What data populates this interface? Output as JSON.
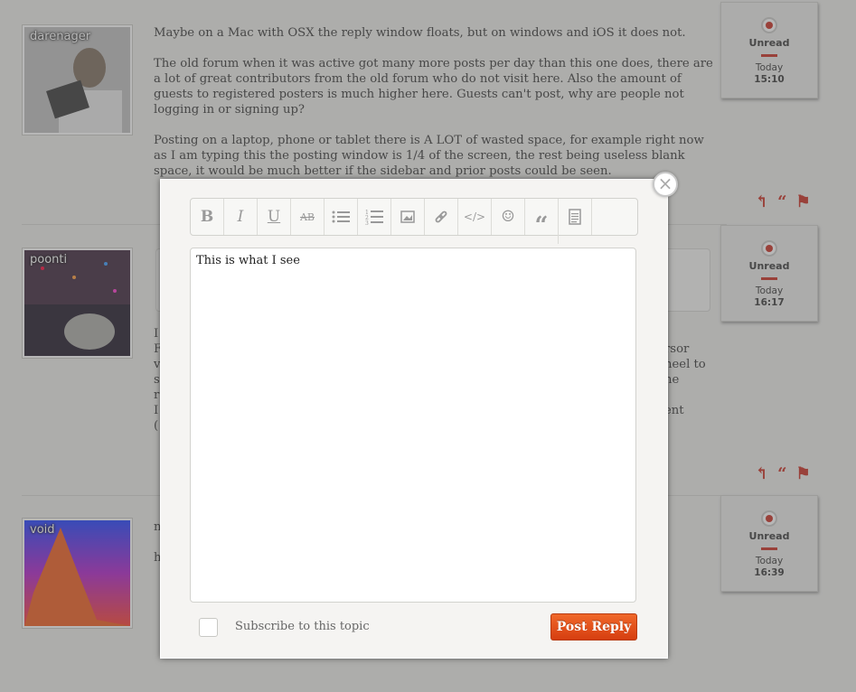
{
  "posts": [
    {
      "username": "darenager",
      "paragraphs": [
        "Maybe on a Mac with OSX the reply window floats, but on windows and iOS it does not.",
        "The old forum when it was active got many more posts per day than this one does, there are a lot of great contributors from the old forum who do not visit here. Also the amount of guests to registered posters is much higher here. Guests can't post, why are people not logging in or signing up?",
        "Posting on a laptop, phone or tablet there is A LOT of wasted space, for example right now as I am typing this the posting window is 1/4 of the screen, the rest being useless blank space, it would be much better if the sidebar and prior posts could be seen."
      ],
      "status": "Unread",
      "day": "Today",
      "time": "15:10"
    },
    {
      "username": "poonti",
      "fragments": [
        "I",
        "F",
        "v",
        "s",
        "r",
        "I",
        "("
      ],
      "right_fragments": [
        "rsor",
        "heel to",
        "he",
        "",
        "ent"
      ],
      "status": "Unread",
      "day": "Today",
      "time": "16:17"
    },
    {
      "username": "void",
      "fragments": [
        "n",
        "h"
      ],
      "status": "Unread",
      "day": "Today",
      "time": "16:39"
    }
  ],
  "actions": {
    "reply_icon": "reply-arrow-icon",
    "quote_icon": "quote-icon",
    "flag_icon": "flag-icon"
  },
  "modal": {
    "close_glyph": "×",
    "toolbar": [
      {
        "name": "bold-button",
        "glyph": "B"
      },
      {
        "name": "italic-button",
        "glyph": "I"
      },
      {
        "name": "underline-button",
        "glyph": "U"
      },
      {
        "name": "strikethrough-button",
        "glyph": "AB"
      },
      {
        "name": "bulleted-list-button",
        "glyph": "≡"
      },
      {
        "name": "numbered-list-button",
        "glyph": "≡"
      },
      {
        "name": "image-button",
        "glyph": "▣"
      },
      {
        "name": "link-button",
        "glyph": "⊗"
      },
      {
        "name": "code-button",
        "glyph": "</>"
      },
      {
        "name": "emoji-button",
        "glyph": "☺"
      },
      {
        "name": "quote-button",
        "glyph": "“"
      },
      {
        "name": "document-button",
        "glyph": "▤"
      }
    ],
    "editor_text": "This is what I see",
    "subscribe_label": "Subscribe to this topic",
    "post_reply_label": "Post Reply"
  },
  "colors": {
    "accent_red": "#c8291c",
    "button_orange": "#e85420"
  }
}
